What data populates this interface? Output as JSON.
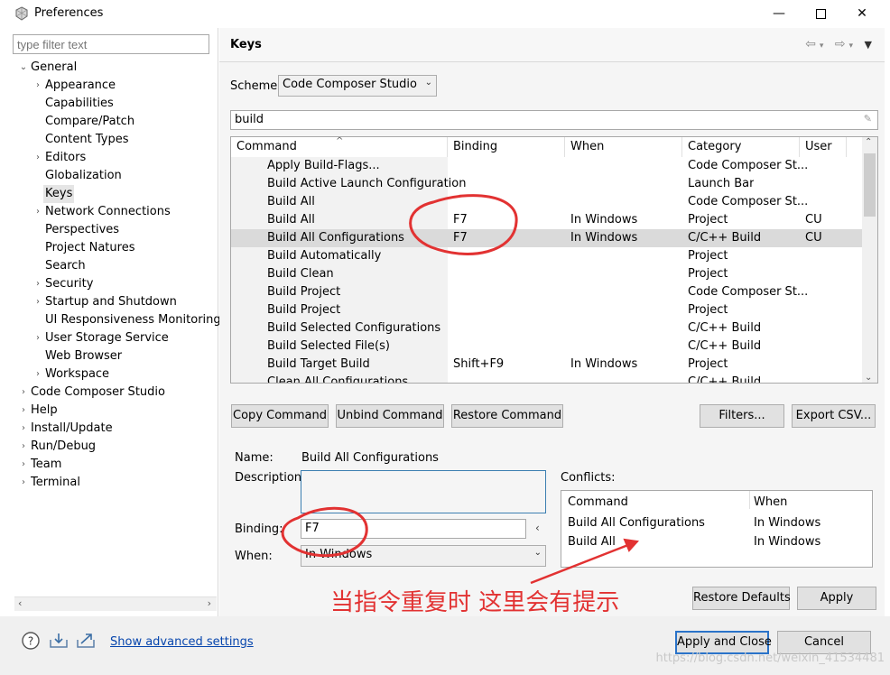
{
  "window": {
    "title": "Preferences"
  },
  "left": {
    "filter_placeholder": "type filter text",
    "tree": [
      {
        "label": "General",
        "level": 0,
        "expanded": true
      },
      {
        "label": "Appearance",
        "level": 1,
        "chevron": true
      },
      {
        "label": "Capabilities",
        "level": 1
      },
      {
        "label": "Compare/Patch",
        "level": 1
      },
      {
        "label": "Content Types",
        "level": 1
      },
      {
        "label": "Editors",
        "level": 1,
        "chevron": true
      },
      {
        "label": "Globalization",
        "level": 1
      },
      {
        "label": "Keys",
        "level": 1,
        "selected": true
      },
      {
        "label": "Network Connections",
        "level": 1,
        "chevron": true
      },
      {
        "label": "Perspectives",
        "level": 1
      },
      {
        "label": "Project Natures",
        "level": 1
      },
      {
        "label": "Search",
        "level": 1
      },
      {
        "label": "Security",
        "level": 1,
        "chevron": true
      },
      {
        "label": "Startup and Shutdown",
        "level": 1,
        "chevron": true
      },
      {
        "label": "UI Responsiveness Monitoring",
        "level": 1
      },
      {
        "label": "User Storage Service",
        "level": 1,
        "chevron": true
      },
      {
        "label": "Web Browser",
        "level": 1
      },
      {
        "label": "Workspace",
        "level": 1,
        "chevron": true
      },
      {
        "label": "Code Composer Studio",
        "level": 0,
        "chevron": true
      },
      {
        "label": "Help",
        "level": 0,
        "chevron": true
      },
      {
        "label": "Install/Update",
        "level": 0,
        "chevron": true
      },
      {
        "label": "Run/Debug",
        "level": 0,
        "chevron": true
      },
      {
        "label": "Team",
        "level": 0,
        "chevron": true
      },
      {
        "label": "Terminal",
        "level": 0,
        "chevron": true
      }
    ]
  },
  "page": {
    "title": "Keys",
    "scheme_label": "Scheme:",
    "scheme_value": "Code Composer Studio",
    "search_value": "build",
    "columns": [
      "Command",
      "Binding",
      "When",
      "Category",
      "User"
    ],
    "rows": [
      {
        "command": "Apply Build-Flags...",
        "binding": "",
        "when": "",
        "category": "Code Composer St...",
        "user": ""
      },
      {
        "command": "Build Active Launch Configuration",
        "binding": "",
        "when": "",
        "category": "Launch Bar",
        "user": ""
      },
      {
        "command": "Build All",
        "binding": "",
        "when": "",
        "category": "Code Composer St...",
        "user": ""
      },
      {
        "command": "Build All",
        "binding": "F7",
        "when": "In Windows",
        "category": "Project",
        "user": "CU"
      },
      {
        "command": "Build All Configurations",
        "binding": "F7",
        "when": "In Windows",
        "category": "C/C++ Build",
        "user": "CU",
        "selected": true
      },
      {
        "command": "Build Automatically",
        "binding": "",
        "when": "",
        "category": "Project",
        "user": ""
      },
      {
        "command": "Build Clean",
        "binding": "",
        "when": "",
        "category": "Project",
        "user": ""
      },
      {
        "command": "Build Project",
        "binding": "",
        "when": "",
        "category": "Code Composer St...",
        "user": ""
      },
      {
        "command": "Build Project",
        "binding": "",
        "when": "",
        "category": "Project",
        "user": ""
      },
      {
        "command": "Build Selected Configurations",
        "binding": "",
        "when": "",
        "category": "C/C++ Build",
        "user": ""
      },
      {
        "command": "Build Selected File(s)",
        "binding": "",
        "when": "",
        "category": "C/C++ Build",
        "user": ""
      },
      {
        "command": "Build Target Build",
        "binding": "Shift+F9",
        "when": "In Windows",
        "category": "Project",
        "user": ""
      },
      {
        "command": "Clean All Configurations",
        "binding": "",
        "when": "",
        "category": "C/C++ Build",
        "user": ""
      }
    ],
    "buttons": {
      "copy": "Copy Command",
      "unbind": "Unbind Command",
      "restore": "Restore Command",
      "filters": "Filters...",
      "export": "Export CSV..."
    },
    "details": {
      "name_label": "Name:",
      "name_value": "Build All Configurations",
      "description_label": "Description:",
      "binding_label": "Binding:",
      "binding_value": "F7",
      "when_label": "When:",
      "when_value": "In Windows"
    },
    "conflicts": {
      "label": "Conflicts:",
      "columns": [
        "Command",
        "When"
      ],
      "rows": [
        {
          "command": "Build All Configurations",
          "when": "In Windows"
        },
        {
          "command": "Build All",
          "when": "In Windows"
        }
      ]
    },
    "restore_defaults": "Restore Defaults",
    "apply": "Apply"
  },
  "footer": {
    "advanced_link": "Show advanced settings",
    "apply_close": "Apply and Close",
    "cancel": "Cancel"
  },
  "annotation": {
    "text": "当指令重复时  这里会有提示",
    "color": "#e23232"
  },
  "watermark": "https://blog.csdn.net/weixin_41534481"
}
